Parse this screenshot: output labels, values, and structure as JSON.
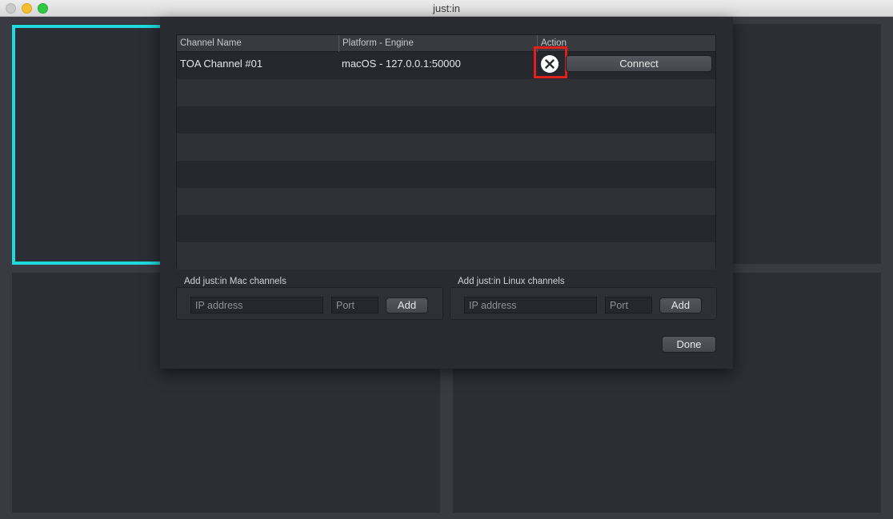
{
  "window": {
    "title": "just:in",
    "traffic_lights": [
      "close",
      "minimize",
      "maximize"
    ]
  },
  "colors": {
    "focus_ring": "#1fd9dd",
    "highlight": "#e0201a",
    "sheet_bg": "#2a2b31"
  },
  "table": {
    "columns": [
      "Channel Name",
      "Platform - Engine",
      "Action"
    ],
    "rows": [
      {
        "channel_name": "TOA Channel #01",
        "platform_engine": "macOS - 127.0.0.1:50000",
        "remove_icon": "close-circle-icon",
        "connect_label": "Connect"
      }
    ]
  },
  "mac_group": {
    "label": "Add just:in Mac channels",
    "ip_placeholder": "IP address",
    "port_placeholder": "Port",
    "add_label": "Add"
  },
  "linux_group": {
    "label": "Add just:in Linux channels",
    "ip_placeholder": "IP address",
    "port_placeholder": "Port",
    "add_label": "Add"
  },
  "done_label": "Done"
}
